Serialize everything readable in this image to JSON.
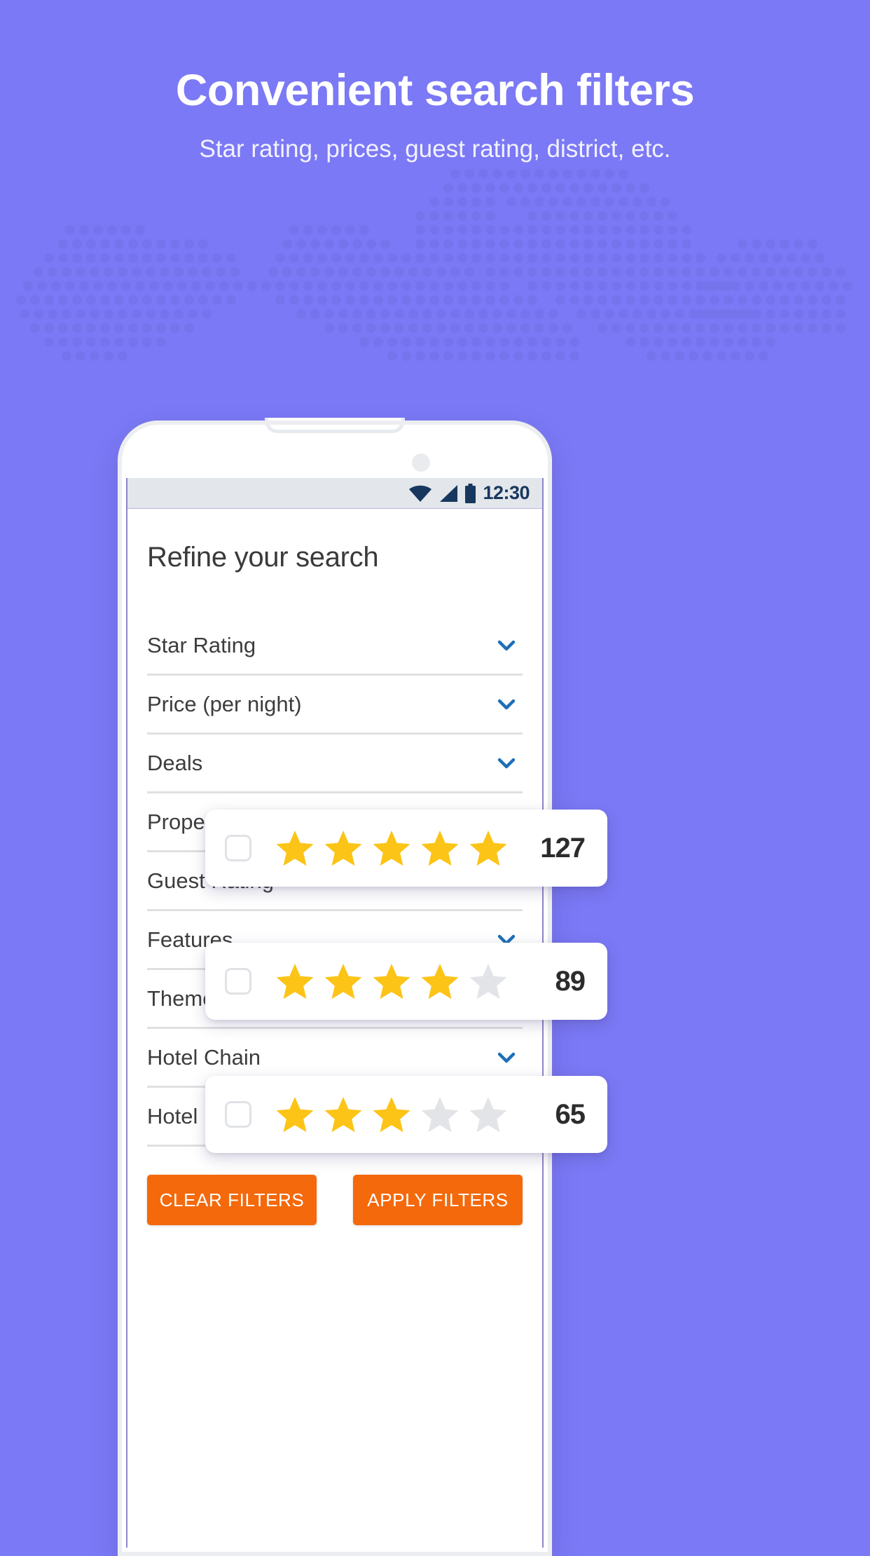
{
  "promo": {
    "headline": "Convenient search filters",
    "subhead": "Star rating, prices, guest rating, district, etc.",
    "background_color": "#7b79f5",
    "dot_color": "#7370e8"
  },
  "device": {
    "statusbar": {
      "time": "12:30",
      "icons": [
        "wifi-icon",
        "cellular-signal-icon",
        "battery-icon"
      ],
      "icon_color": "#17375e",
      "background": "#e3e6ea"
    }
  },
  "app": {
    "title": "Refine your search",
    "chevron_color": "#1d6fb8",
    "filters": [
      {
        "label": "Star Rating",
        "icon": "chevron-down-icon"
      },
      {
        "label": "Price (per night)",
        "icon": "chevron-down-icon"
      },
      {
        "label": "Deals",
        "icon": "chevron-down-icon"
      },
      {
        "label": "Property Type",
        "icon": "chevron-down-icon"
      },
      {
        "label": "Guest Rating",
        "icon": "chevron-down-icon"
      },
      {
        "label": "Features",
        "icon": "chevron-down-icon"
      },
      {
        "label": "Themes",
        "icon": "chevron-down-icon"
      },
      {
        "label": "Hotel Chain",
        "icon": "chevron-down-icon"
      },
      {
        "label": "Hotel Name Contains",
        "icon": "chevron-down-icon"
      }
    ],
    "buttons": {
      "clear_label": "CLEAR FILTERS",
      "apply_label": "APPLY FILTERS",
      "color": "#f4690b"
    }
  },
  "star_cards": {
    "filled_color": "#fcc417",
    "empty_color": "#e2e4e8",
    "items": [
      {
        "stars_filled": 5,
        "stars_total": 5,
        "count": "127",
        "checked": false
      },
      {
        "stars_filled": 4,
        "stars_total": 5,
        "count": "89",
        "checked": false
      },
      {
        "stars_filled": 3,
        "stars_total": 5,
        "count": "65",
        "checked": false
      }
    ]
  }
}
